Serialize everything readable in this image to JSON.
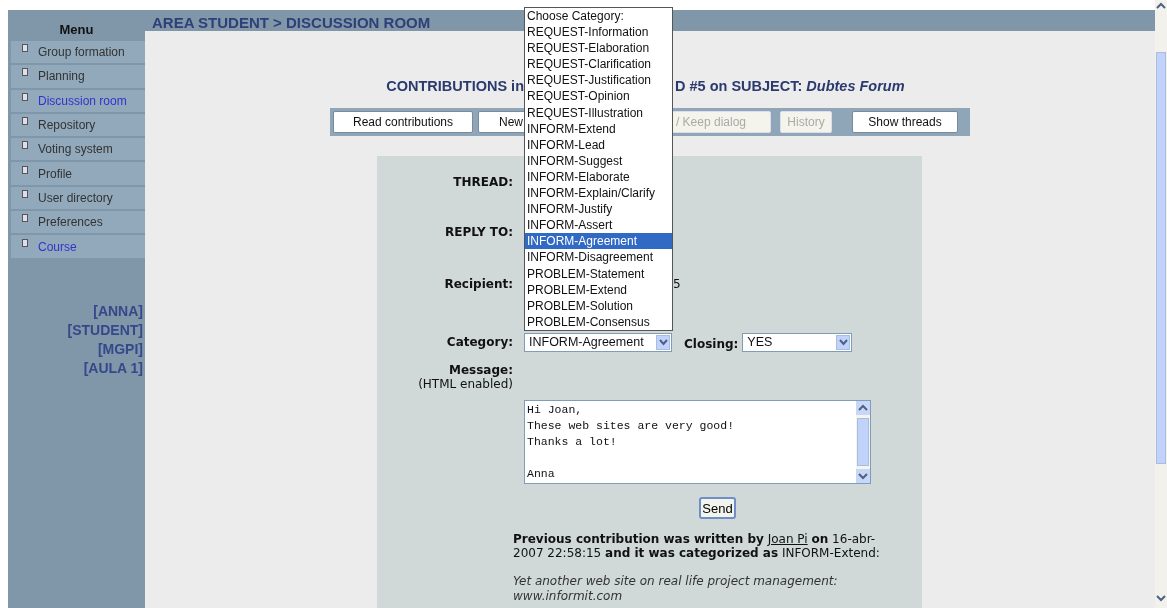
{
  "sidebar": {
    "title": "Menu",
    "items": [
      {
        "label": "Group formation",
        "highlighted": false
      },
      {
        "label": "Planning",
        "highlighted": false
      },
      {
        "label": "Discussion room",
        "highlighted": true
      },
      {
        "label": "Repository",
        "highlighted": false
      },
      {
        "label": "Voting system",
        "highlighted": false
      },
      {
        "label": "Profile",
        "highlighted": false
      },
      {
        "label": "User directory",
        "highlighted": false
      },
      {
        "label": "Preferences",
        "highlighted": false
      },
      {
        "label": "Course",
        "highlighted": true
      }
    ],
    "user_info": [
      "[ANNA]",
      "[STUDENT]",
      "[MGPI]",
      "[AULA 1]"
    ]
  },
  "header": {
    "title": "AREA STUDENT > DISCUSSION ROOM"
  },
  "heading": {
    "left": "CONTRIBUTIONS in",
    "right": "D #5 on SUBJECT: *Dubtes Forum*"
  },
  "toolbar": [
    {
      "label": "Read contributions",
      "disabled": false
    },
    {
      "label": "New",
      "disabled": false
    },
    {
      "label": "/ Keep dialog",
      "disabled": true
    },
    {
      "label": "History",
      "disabled": true
    },
    {
      "label": "Show threads",
      "disabled": false
    }
  ],
  "form": {
    "thread": {
      "label": "THREAD:"
    },
    "reply_to": {
      "label": "REPLY TO:"
    },
    "recipient": {
      "label": "Recipient:",
      "value_end": "5"
    },
    "category": {
      "label": "Category:",
      "value": "INFORM-Agreement"
    },
    "closing": {
      "label": "Closing:",
      "value": "YES"
    },
    "message": {
      "label": "Message:",
      "hint": "(HTML enabled)",
      "value": "Hi Joan,\nThese web sites are very good!\nThanks a lot!\n\nAnna"
    },
    "send": "Send"
  },
  "previous": {
    "text": "**Previous contribution was written by**",
    "author": "Joan Pi",
    "rest": "**on** 16-abr-2007 22:58:15 **and it was categorized as** INFORM-Extend:",
    "quote": "Yet another web site on real life project management: www.informit.com"
  },
  "dropdown": {
    "options": [
      {
        "label": "Choose Category:",
        "selected": false
      },
      {
        "label": "REQUEST-Information",
        "selected": false
      },
      {
        "label": "REQUEST-Elaboration",
        "selected": false
      },
      {
        "label": "REQUEST-Clarification",
        "selected": false
      },
      {
        "label": "REQUEST-Justification",
        "selected": false
      },
      {
        "label": "REQUEST-Opinion",
        "selected": false
      },
      {
        "label": "REQUEST-Illustration",
        "selected": false
      },
      {
        "label": "INFORM-Extend",
        "selected": false
      },
      {
        "label": "INFORM-Lead",
        "selected": false
      },
      {
        "label": "INFORM-Suggest",
        "selected": false
      },
      {
        "label": "INFORM-Elaborate",
        "selected": false
      },
      {
        "label": "INFORM-Explain/Clarify",
        "selected": false
      },
      {
        "label": "INFORM-Justify",
        "selected": false
      },
      {
        "label": "INFORM-Assert",
        "selected": false
      },
      {
        "label": "INFORM-Agreement",
        "selected": true
      },
      {
        "label": "INFORM-Disagreement",
        "selected": false
      },
      {
        "label": "PROBLEM-Statement",
        "selected": false
      },
      {
        "label": "PROBLEM-Extend",
        "selected": false
      },
      {
        "label": "PROBLEM-Solution",
        "selected": false
      },
      {
        "label": "PROBLEM-Consensus",
        "selected": false
      }
    ]
  }
}
